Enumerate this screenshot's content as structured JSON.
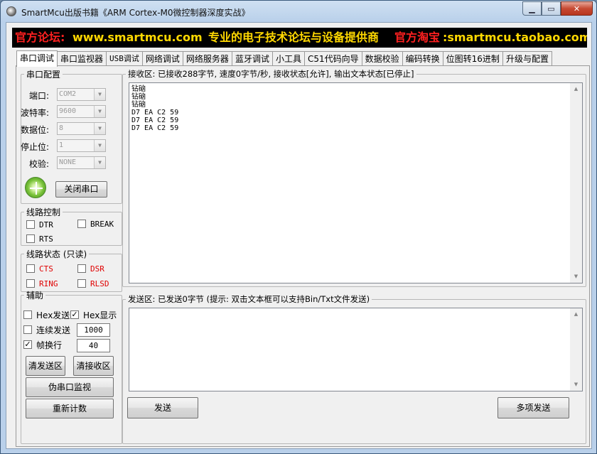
{
  "window": {
    "title": "SmartMcu出版书籍《ARM Cortex-M0微控制器深度实战》",
    "minimize": "▁",
    "maximize": "▭",
    "close": "✕"
  },
  "banner": {
    "forum_label": "官方论坛:",
    "forum_url": "www.smartmcu.com",
    "slogan": "专业的电子技术论坛与设备提供商",
    "shop_label": "官方淘宝",
    "shop_url": ":smartmcu.taobao.com"
  },
  "tabs": [
    "串口调试",
    "串口监视器",
    "USB调试",
    "网络调试",
    "网络服务器",
    "蓝牙调试",
    "小工具",
    "C51代码向导",
    "数据校验",
    "编码转换",
    "位图转16进制",
    "升级与配置"
  ],
  "serial_config": {
    "title": "串口配置",
    "port_label": "端口:",
    "port_value": "COM2",
    "baud_label": "波特率:",
    "baud_value": "9600",
    "databits_label": "数据位:",
    "databits_value": "8",
    "stopbits_label": "停止位:",
    "stopbits_value": "1",
    "parity_label": "校验:",
    "parity_value": "NONE",
    "close_port_button": "关闭串口"
  },
  "line_control": {
    "title": "线路控制",
    "dtr": "DTR",
    "break": "BREAK",
    "rts": "RTS"
  },
  "line_status": {
    "title": "线路状态 (只读)",
    "cts": "CTS",
    "dsr": "DSR",
    "ring": "RING",
    "rlsd": "RLSD"
  },
  "aux": {
    "title": "辅助",
    "hex_send": "Hex发送",
    "hex_display": "Hex显示",
    "continuous_send": "连续发送",
    "interval_value": "1000",
    "frame_newline": "帧换行",
    "frame_value": "40",
    "clear_send_button": "清发送区",
    "clear_receive_button": "清接收区",
    "fake_monitor_button": "伪串口监视",
    "recount_button": "重新计数"
  },
  "receive": {
    "title": "接收区: 已接收288字节, 速度0字节/秒, 接收状态[允许], 输出文本状态[已停止]",
    "content": "钻硇\n钻硇\n钻硇\nD7 EA C2 59\nD7 EA C2 59\nD7 EA C2 59"
  },
  "send": {
    "title": "发送区: 已发送0字节 (提示: 双击文本框可以支持Bin/Txt文件发送)",
    "content": "",
    "send_button": "发送",
    "multi_send_button": "多项发送"
  }
}
